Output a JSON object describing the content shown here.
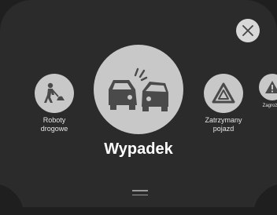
{
  "close": {
    "icon": "close-icon"
  },
  "items": [
    {
      "label_line1": "Roboty",
      "label_line2": "drogowe",
      "icon": "road-works-icon"
    },
    {
      "label": "Wypadek",
      "icon": "car-crash-icon"
    },
    {
      "label_line1": "Zatrzymany",
      "label_line2": "pojazd",
      "icon": "hazard-triangle-icon"
    },
    {
      "label": "Zagroż…",
      "icon": "warning-icon"
    }
  ],
  "colors": {
    "background": "#2b2b2b",
    "circle": "#c8c8c8",
    "icon": "#4a4a4a",
    "text": "#ffffff"
  }
}
